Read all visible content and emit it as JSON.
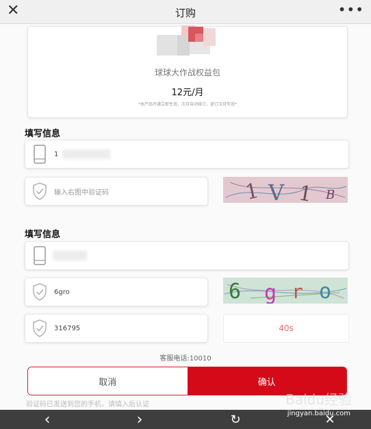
{
  "header": {
    "title": "订购",
    "close_icon": "close-icon",
    "more_icon": "more-icon"
  },
  "product": {
    "name": "球球大作战权益包",
    "price": "12元/月",
    "note": "*本产品开通立即生效，次月自动续订，退订次月失效*"
  },
  "section1": {
    "title": "填写信息",
    "phone_value": "1",
    "captcha_placeholder": "输入右图中验证码",
    "captcha_image_text": "1V1B"
  },
  "section2": {
    "title": "填写信息",
    "captcha_value": "6gro",
    "captcha_image_text": "6gro",
    "sms_code_value": "316795",
    "countdown": "40s"
  },
  "service_phone": "客服电话:10010",
  "buttons": {
    "cancel": "取消",
    "confirm": "确认"
  },
  "hint": "验证码已发送到您的手机，请填入后认证",
  "watermark": {
    "text": "Baidu经验",
    "url": "jingyan.baidu.com"
  },
  "colors": {
    "accent": "#d40a18",
    "countdown": "#e86a6a"
  }
}
